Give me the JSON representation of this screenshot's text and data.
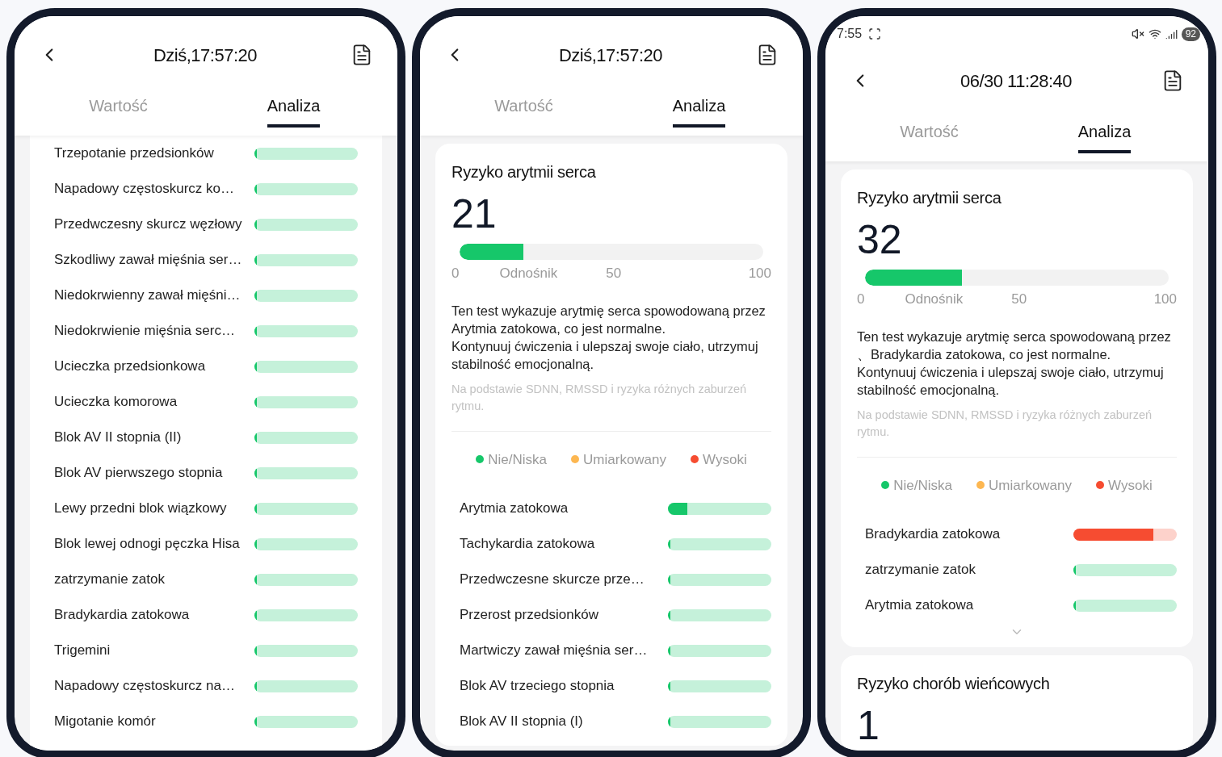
{
  "phones": [
    {
      "title": "Dziś,17:57:20",
      "tabs": [
        {
          "label": "Wartość",
          "selected": false
        },
        {
          "label": "Analiza",
          "selected": true
        }
      ],
      "conditions": [
        {
          "name": "Trzepotanie przedsionków",
          "color": "#16c76a",
          "level": 0.02
        },
        {
          "name": "Napadowy częstoskurcz ko…",
          "color": "#16c76a",
          "level": 0.02
        },
        {
          "name": "Przedwczesny skurcz węzłowy",
          "color": "#16c76a",
          "level": 0.02
        },
        {
          "name": "Szkodliwy zawał mięśnia ser…",
          "color": "#16c76a",
          "level": 0.02
        },
        {
          "name": "Niedokrwienny zawał mięśni…",
          "color": "#16c76a",
          "level": 0.02
        },
        {
          "name": "Niedokrwienie mięśnia serc…",
          "color": "#16c76a",
          "level": 0.02
        },
        {
          "name": "Ucieczka przedsionkowa",
          "color": "#16c76a",
          "level": 0.02
        },
        {
          "name": "Ucieczka komorowa",
          "color": "#16c76a",
          "level": 0.02
        },
        {
          "name": "Blok AV II stopnia (II)",
          "color": "#16c76a",
          "level": 0.02
        },
        {
          "name": "Blok AV pierwszego stopnia",
          "color": "#16c76a",
          "level": 0.02
        },
        {
          "name": "Lewy przedni blok wiązkowy",
          "color": "#16c76a",
          "level": 0.02
        },
        {
          "name": "Blok lewej odnogi pęczka Hisa",
          "color": "#16c76a",
          "level": 0.02
        },
        {
          "name": "zatrzymanie zatok",
          "color": "#16c76a",
          "level": 0.02
        },
        {
          "name": "Bradykardia zatokowa",
          "color": "#16c76a",
          "level": 0.02
        },
        {
          "name": "Trigemini",
          "color": "#16c76a",
          "level": 0.02
        },
        {
          "name": "Napadowy częstoskurcz na…",
          "color": "#16c76a",
          "level": 0.02
        },
        {
          "name": "Migotanie komór",
          "color": "#16c76a",
          "level": 0.02
        }
      ]
    },
    {
      "title": "Dziś,17:57:20",
      "tabs": [
        {
          "label": "Wartość",
          "selected": false
        },
        {
          "label": "Analiza",
          "selected": true
        }
      ],
      "cards": [
        {
          "title": "Ryzyko arytmii serca",
          "score": "21",
          "level": 0.21,
          "scale": [
            "0",
            "Odnośnik",
            "50",
            "100"
          ],
          "description": [
            "Ten test wykazuje arytmię serca spowodowaną przez Arytmia zatokowa, co jest normalne.",
            "Kontynuuj ćwiczenia i ulepszaj swoje ciało, utrzymuj stabilność emocjonalną."
          ],
          "note": "Na podstawie SDNN, RMSSD i ryzyka różnych zaburzeń rytmu.",
          "legend": [
            {
              "label": "Nie/Niska",
              "color": "#16c76a"
            },
            {
              "label": "Umiarkowany",
              "color": "#fdb751"
            },
            {
              "label": "Wysoki",
              "color": "#f64c31"
            }
          ],
          "conditions": [
            {
              "name": "Arytmia zatokowa",
              "color": "#16c76a",
              "level": 0.19
            },
            {
              "name": "Tachykardia zatokowa",
              "color": "#16c76a",
              "level": 0.02
            },
            {
              "name": "Przedwczesne skurcze prze…",
              "color": "#16c76a",
              "level": 0.02
            },
            {
              "name": "Przerost przedsionków",
              "color": "#16c76a",
              "level": 0.02
            },
            {
              "name": "Martwiczy zawał mięśnia ser…",
              "color": "#16c76a",
              "level": 0.02
            },
            {
              "name": "Blok AV trzeciego stopnia",
              "color": "#16c76a",
              "level": 0.02
            },
            {
              "name": "Blok AV II stopnia (I)",
              "color": "#16c76a",
              "level": 0.02
            }
          ]
        }
      ]
    },
    {
      "status_bar": {
        "time": "7:55",
        "battery": "92"
      },
      "title": "06/30 11:28:40",
      "tabs": [
        {
          "label": "Wartość",
          "selected": false
        },
        {
          "label": "Analiza",
          "selected": true
        }
      ],
      "cards": [
        {
          "title": "Ryzyko arytmii serca",
          "score": "32",
          "level": 0.32,
          "scale": [
            "0",
            "Odnośnik",
            "50",
            "100"
          ],
          "description": [
            "Ten test wykazuje arytmię serca spowodowaną przez 、Bradykardia zatokowa, co jest normalne.",
            "Kontynuuj ćwiczenia i ulepszaj swoje ciało, utrzymuj stabilność emocjonalną."
          ],
          "note": "Na podstawie SDNN, RMSSD i ryzyka różnych zaburzeń rytmu.",
          "legend": [
            {
              "label": "Nie/Niska",
              "color": "#16c76a"
            },
            {
              "label": "Umiarkowany",
              "color": "#fdb751"
            },
            {
              "label": "Wysoki",
              "color": "#f64c31"
            }
          ],
          "conditions": [
            {
              "name": "Bradykardia zatokowa",
              "color": "#f64c31",
              "level": 0.77
            },
            {
              "name": "zatrzymanie zatok",
              "color": "#16c76a",
              "level": 0.02
            },
            {
              "name": "Arytmia zatokowa",
              "color": "#16c76a",
              "level": 0.02
            }
          ],
          "expandable": true
        },
        {
          "title": "Ryzyko chorób wieńcowych",
          "score": "1"
        }
      ]
    }
  ]
}
